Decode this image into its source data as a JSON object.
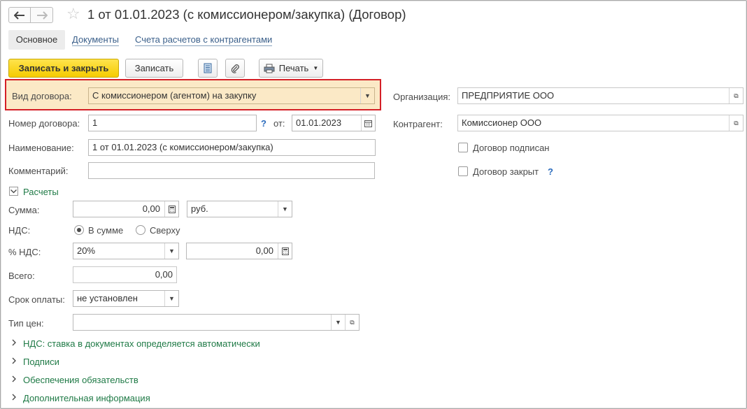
{
  "window": {
    "title": "1 от 01.01.2023 (с комиссионером/закупка) (Договор)"
  },
  "tabs": [
    {
      "label": "Основное"
    },
    {
      "label": "Документы"
    },
    {
      "label": "Счета расчетов с контрагентами"
    }
  ],
  "toolbar": {
    "save_close_label": "Записать и закрыть",
    "save_label": "Записать",
    "print_label": "Печать"
  },
  "form": {
    "contract_type": {
      "label": "Вид договора:",
      "value": "С комиссионером (агентом) на закупку"
    },
    "number": {
      "label": "Номер договора:",
      "value": "1"
    },
    "date": {
      "label": "от:",
      "value": "01.01.2023"
    },
    "name": {
      "label": "Наименование:",
      "value": "1 от 01.01.2023 (с комиссионером/закупка)"
    },
    "comment": {
      "label": "Комментарий:",
      "value": ""
    },
    "organization": {
      "label": "Организация:",
      "value": "ПРЕДПРИЯТИЕ ООО"
    },
    "counterparty": {
      "label": "Контрагент:",
      "value": "Комиссионер ООО"
    },
    "signed": {
      "label": "Договор подписан",
      "checked": false
    },
    "closed": {
      "label": "Договор закрыт",
      "checked": false
    },
    "help_mark": "?"
  },
  "payments": {
    "section_label": "Расчеты",
    "sum": {
      "label": "Сумма:",
      "value": "0,00",
      "currency": "руб."
    },
    "vat": {
      "label": "НДС:",
      "options": [
        "В сумме",
        "Сверху"
      ],
      "selected": "В сумме"
    },
    "vat_rate": {
      "label": "% НДС:",
      "value": "20%",
      "amount": "0,00"
    },
    "total": {
      "label": "Всего:",
      "value": "0,00"
    },
    "payment_term": {
      "label": "Срок оплаты:",
      "value": "не установлен"
    },
    "price_type": {
      "label": "Тип цен:",
      "value": ""
    }
  },
  "collapsed_sections": [
    {
      "label": "НДС: ставка в документах определяется автоматически"
    },
    {
      "label": "Подписи"
    },
    {
      "label": "Обеспечения обязательств"
    },
    {
      "label": "Дополнительная информация"
    }
  ],
  "colors": {
    "primary_button": "#f5cc00",
    "highlight_border": "#d42027",
    "highlight_fill": "#fbe9c6",
    "section_link": "#1f7a46",
    "help": "#2a6bbd"
  }
}
